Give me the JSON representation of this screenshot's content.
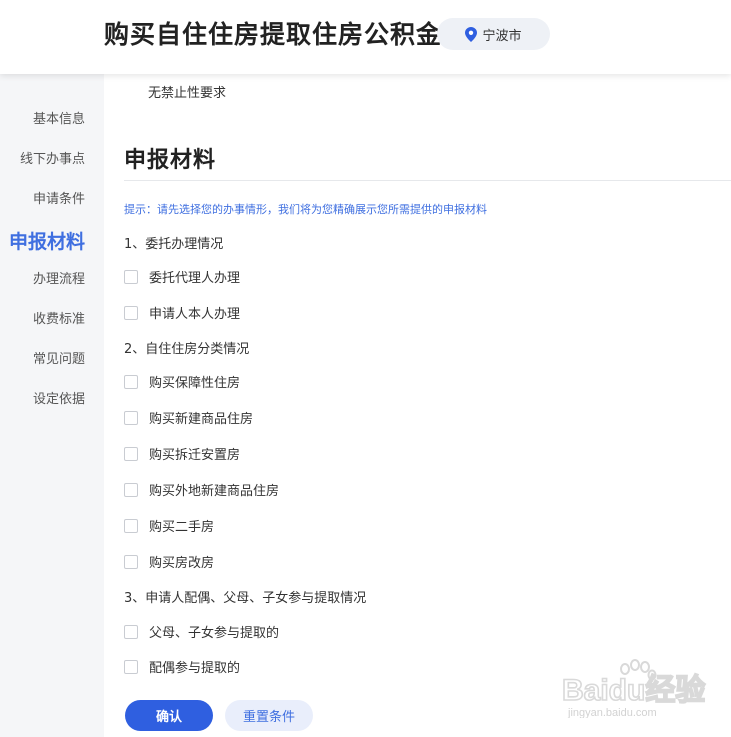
{
  "header": {
    "title": "购买自住住房提取住房公积金",
    "location": "宁波市"
  },
  "sidebar": {
    "items": [
      {
        "label": "基本信息"
      },
      {
        "label": "线下办事点"
      },
      {
        "label": "申请条件"
      },
      {
        "label": "申报材料"
      },
      {
        "label": "办理流程"
      },
      {
        "label": "收费标准"
      },
      {
        "label": "常见问题"
      },
      {
        "label": "设定依据"
      }
    ],
    "active_index": 3
  },
  "main": {
    "previous_text": "无禁止性要求",
    "section_title": "申报材料",
    "hint": "提示：请先选择您的办事情形，我们将为您精确展示您所需提供的申报材料",
    "groups": [
      {
        "title": "1、委托办理情况",
        "options": [
          "委托代理人办理",
          "申请人本人办理"
        ]
      },
      {
        "title": "2、自住住房分类情况",
        "options": [
          "购买保障性住房",
          "购买新建商品住房",
          "购买拆迁安置房",
          "购买外地新建商品住房",
          "购买二手房",
          "购买房改房"
        ]
      },
      {
        "title": "3、申请人配偶、父母、子女参与提取情况",
        "options": [
          "父母、子女参与提取的",
          "配偶参与提取的"
        ]
      }
    ],
    "confirm_label": "确认",
    "reset_label": "重置条件"
  },
  "watermark": {
    "brand": "Baidu经验",
    "url": "jingyan.baidu.com"
  },
  "colors": {
    "accent": "#3f6fe0",
    "primary_button": "#2f5fe0",
    "sidebar_bg": "#f5f6f8",
    "pill_bg": "#eef1f6"
  },
  "icons": {
    "location": "map-pin-icon",
    "watermark": "baidu-paw-icon"
  }
}
